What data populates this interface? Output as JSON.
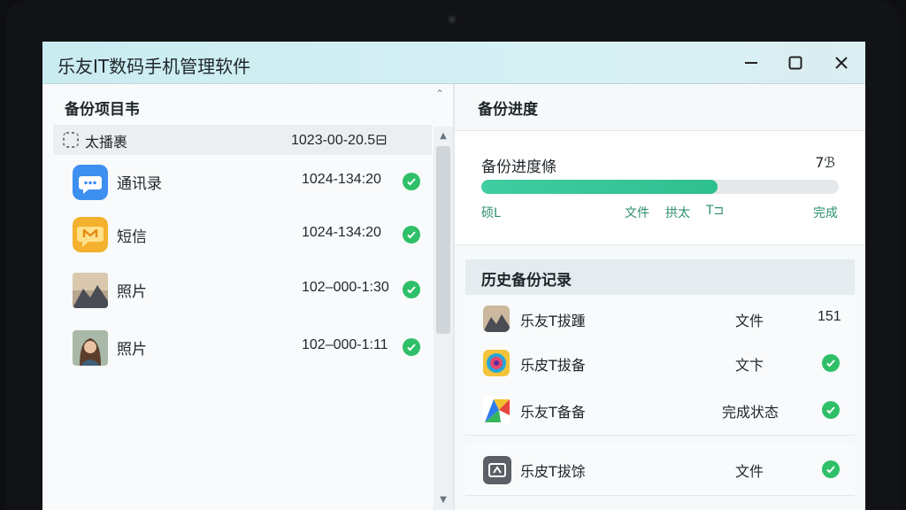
{
  "window": {
    "title": "乐友IT数码手机管理软件"
  },
  "left_panel": {
    "header": "备份项目韦",
    "items": [
      {
        "name": "太播裹",
        "date": "1023-00-20.5⊟",
        "checked": false,
        "icon": "dashed-square-icon"
      },
      {
        "name": "通讯录",
        "date": "1024-134:20",
        "checked": true,
        "icon": "contacts-chat-icon"
      },
      {
        "name": "短信",
        "date": "1024-134:20",
        "checked": true,
        "icon": "sms-icon"
      },
      {
        "name": "照片",
        "date": "102‒000-1:30",
        "checked": true,
        "icon": "mountain-photo-icon"
      },
      {
        "name": "照片",
        "date": "102‒000-1:11",
        "checked": true,
        "icon": "portrait-photo-icon"
      }
    ]
  },
  "right_panel": {
    "header": "备份进度",
    "progress": {
      "title": "备份进度條",
      "percent_text": "7ℬ",
      "fraction": 0.66,
      "steps": [
        "硕L",
        "文件",
        "拱太",
        "T⊐",
        "完成"
      ]
    },
    "history": {
      "header": "历史备份记录",
      "rows": [
        {
          "name": "乐友T拔踵",
          "type": "文件",
          "count": "151",
          "checked": false,
          "icon": "mountain-photo-icon"
        },
        {
          "name": "乐皮T拔备",
          "type": "文卞",
          "count": "",
          "checked": true,
          "icon": "camera-lens-icon"
        },
        {
          "name": "乐友T备备",
          "type": "完成状态",
          "count": "",
          "checked": true,
          "icon": "colorful-app-icon"
        },
        {
          "name": "乐皮T拔馀",
          "type": "文件",
          "count": "",
          "checked": true,
          "icon": "sync-arrows-icon"
        }
      ]
    }
  },
  "colors": {
    "accent": "#2fbf68",
    "progress": "#3fcda1",
    "titlebar": "#cdeef2"
  }
}
